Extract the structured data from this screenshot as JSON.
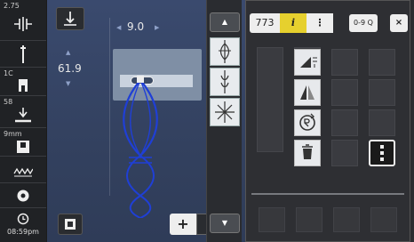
{
  "status": {
    "needle_position": "2.75",
    "presser_foot": "1C",
    "feed_dog": "58",
    "needle_size": "9mm",
    "time": "08:59pm"
  },
  "stitch_settings": {
    "stitch_width": "9.0",
    "stitch_length": "61.9"
  },
  "breadcrumb": {
    "stitch_number": "773",
    "info_label": "i",
    "sub_label": "⋮"
  },
  "toolbar": {
    "search_label": "0-9 Q",
    "close_label": "×"
  },
  "info_button": {
    "label": "i"
  },
  "view_toggle": {
    "a": "+",
    "b": "↘"
  },
  "colors": {
    "accent_yellow": "#e6d02e",
    "stitch_blue": "#1f3fd6",
    "panel_blue": "#3a4a6e"
  }
}
